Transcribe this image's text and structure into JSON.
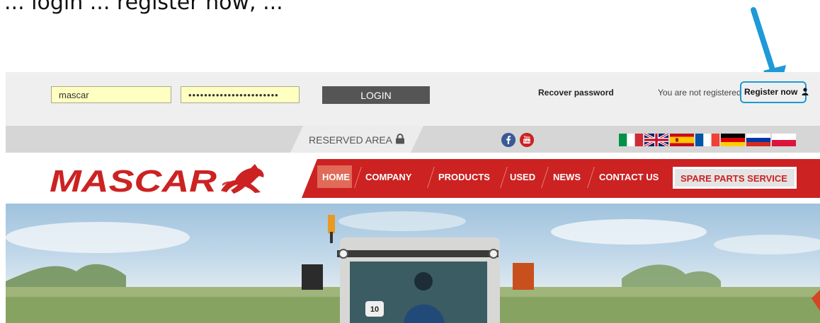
{
  "caption": "... login ... register now, ...",
  "login": {
    "username_value": "mascar",
    "password_value": "•••••••••••••••••••••••",
    "login_label": "LOGIN",
    "recover_label": "Recover password",
    "not_registered_text": "You are not registered",
    "register_label": "Register now",
    "highlight_color": "#1e9ad6"
  },
  "topbar": {
    "reserved_label": "RESERVED AREA",
    "social": [
      "facebook-icon",
      "youtube-icon"
    ],
    "flags": [
      "italy-flag",
      "uk-flag",
      "spain-flag",
      "france-flag",
      "germany-flag",
      "russia-flag",
      "poland-flag"
    ]
  },
  "brand": {
    "logo_text": "MASCAR",
    "primary_color": "#cc2222"
  },
  "nav": {
    "items": [
      "HOME",
      "COMPANY",
      "PRODUCTS",
      "USED",
      "NEWS",
      "CONTACT US"
    ],
    "active": "HOME",
    "spare_parts_label": "SPARE PARTS SERVICE"
  },
  "hero": {
    "plate_number": "10"
  }
}
